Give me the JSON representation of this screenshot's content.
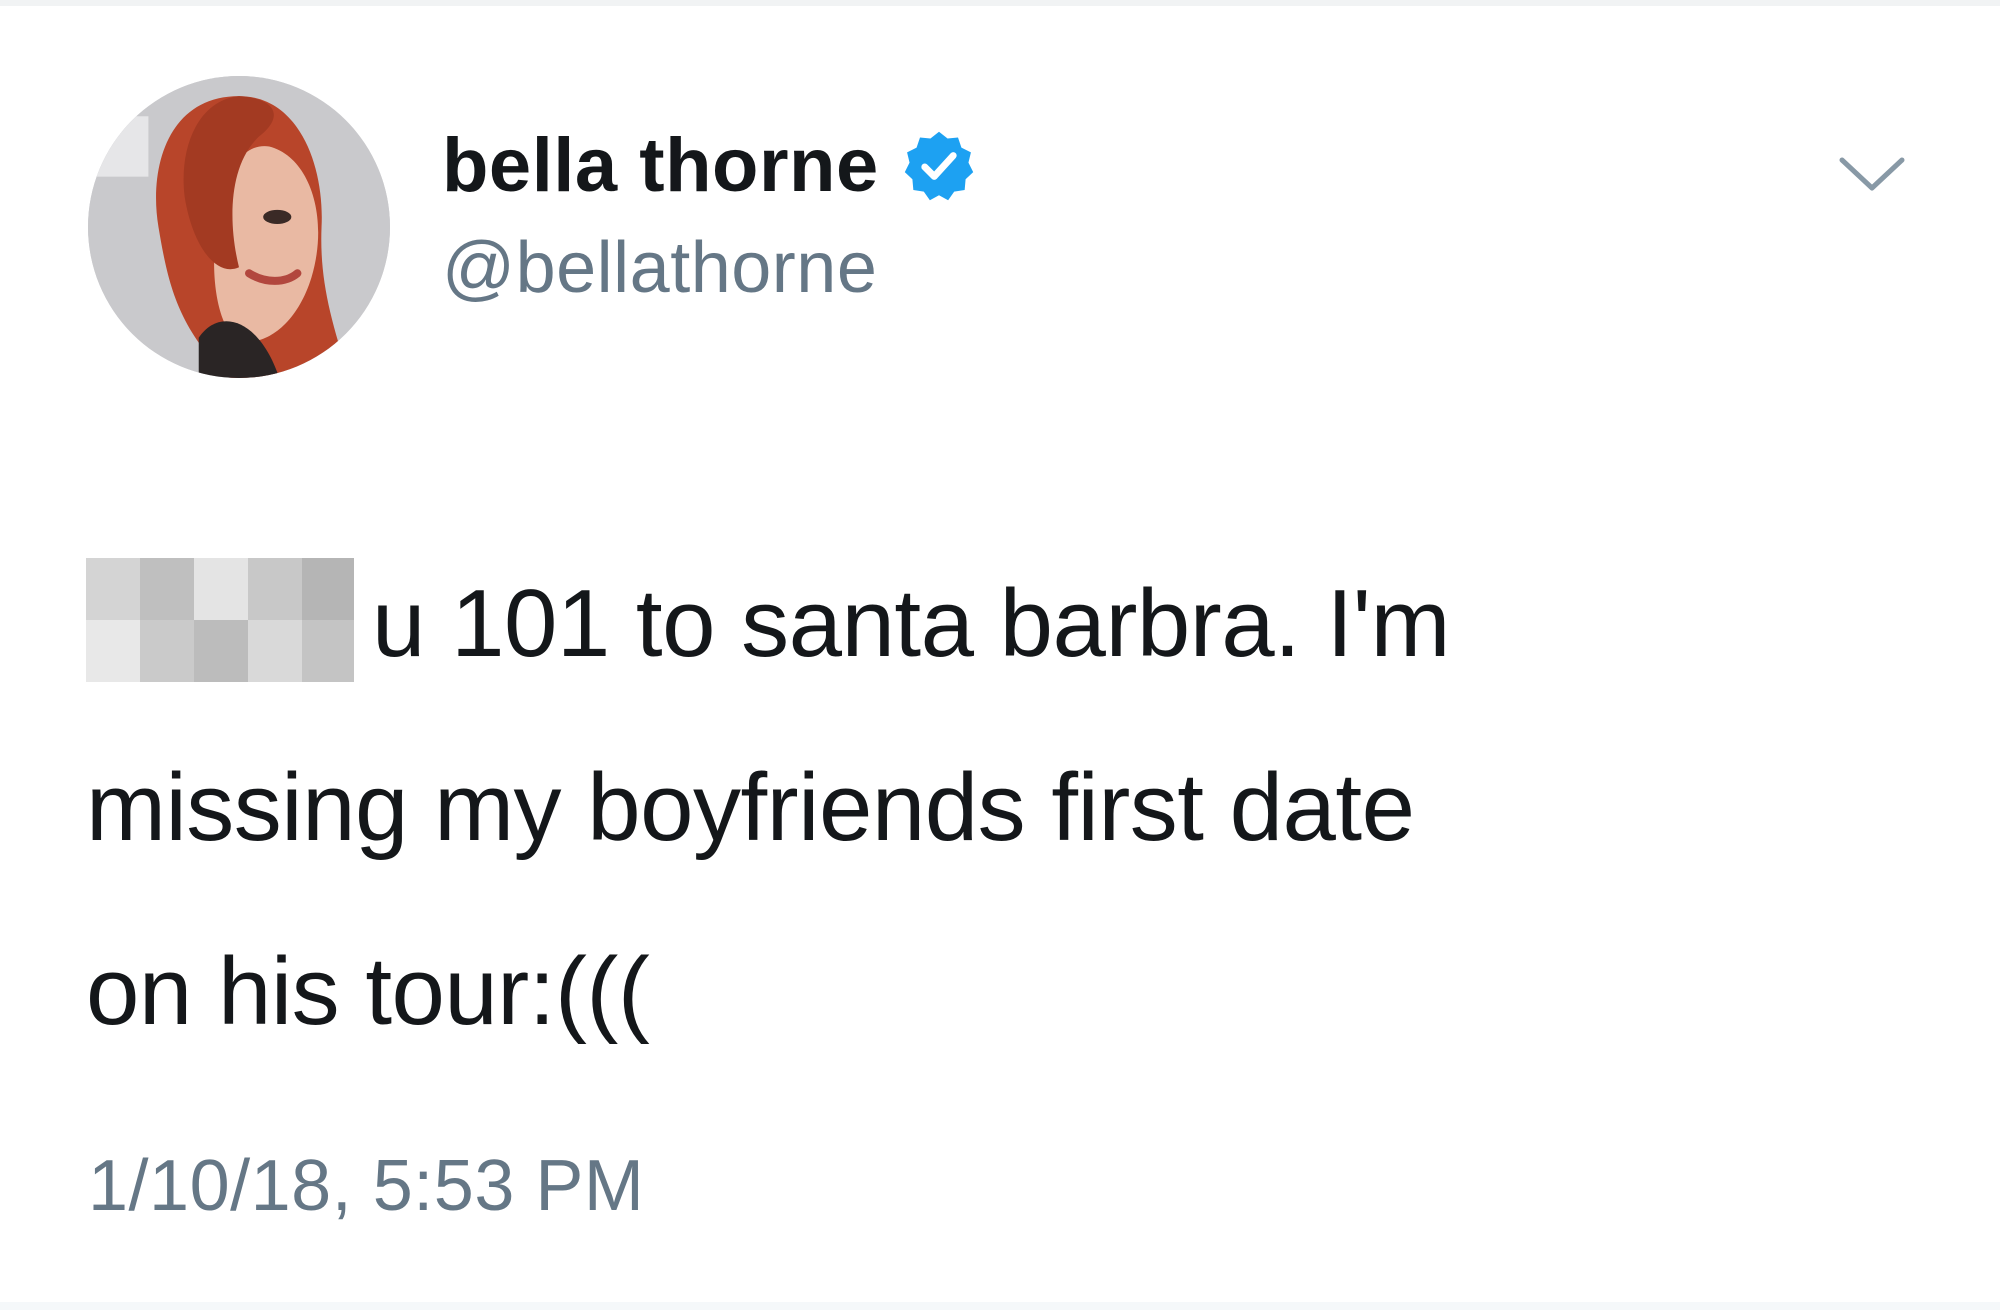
{
  "tweet": {
    "author": {
      "display_name": "bella thorne",
      "handle": "@bellathorne",
      "verified": true,
      "avatar_icon": "profile-photo"
    },
    "text_line_1": "u 101 to santa barbra. I'm",
    "text_line_2": "missing my boyfriends first date",
    "text_line_3": "on his tour:(((",
    "timestamp": "1/10/18, 5:53 PM",
    "menu_icon": "chevron-down-icon"
  },
  "colors": {
    "verified_badge": "#1da1f2",
    "secondary_text": "#657786",
    "primary_text": "#14171a"
  }
}
